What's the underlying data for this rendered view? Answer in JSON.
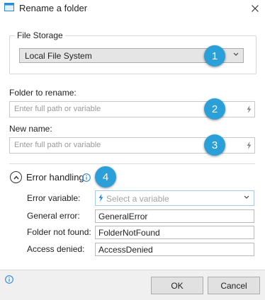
{
  "window": {
    "title": "Rename a folder",
    "icon": "folder-window-icon",
    "close_icon": "close-icon"
  },
  "storage": {
    "group_label": "File Storage",
    "selected": "Local File System"
  },
  "folder_to_rename": {
    "label": "Folder to rename:",
    "placeholder": "Enter full path or variable"
  },
  "new_name": {
    "label": "New name:",
    "placeholder": "Enter full path or variable"
  },
  "badges": [
    "1",
    "2",
    "3",
    "4"
  ],
  "error_handling": {
    "label": "Error handling",
    "variable_label": "Error variable:",
    "variable_placeholder": "Select a variable",
    "rows": [
      {
        "label": "General error:",
        "value": "GeneralError"
      },
      {
        "label": "Folder not found:",
        "value": "FolderNotFound"
      },
      {
        "label": "Access denied:",
        "value": "AccessDenied"
      }
    ]
  },
  "footer": {
    "ok_label": "OK",
    "cancel_label": "Cancel"
  },
  "colors": {
    "badge": "#2a9fd8",
    "info": "#2a8ad4",
    "footer_bg": "#f0f0f0"
  }
}
